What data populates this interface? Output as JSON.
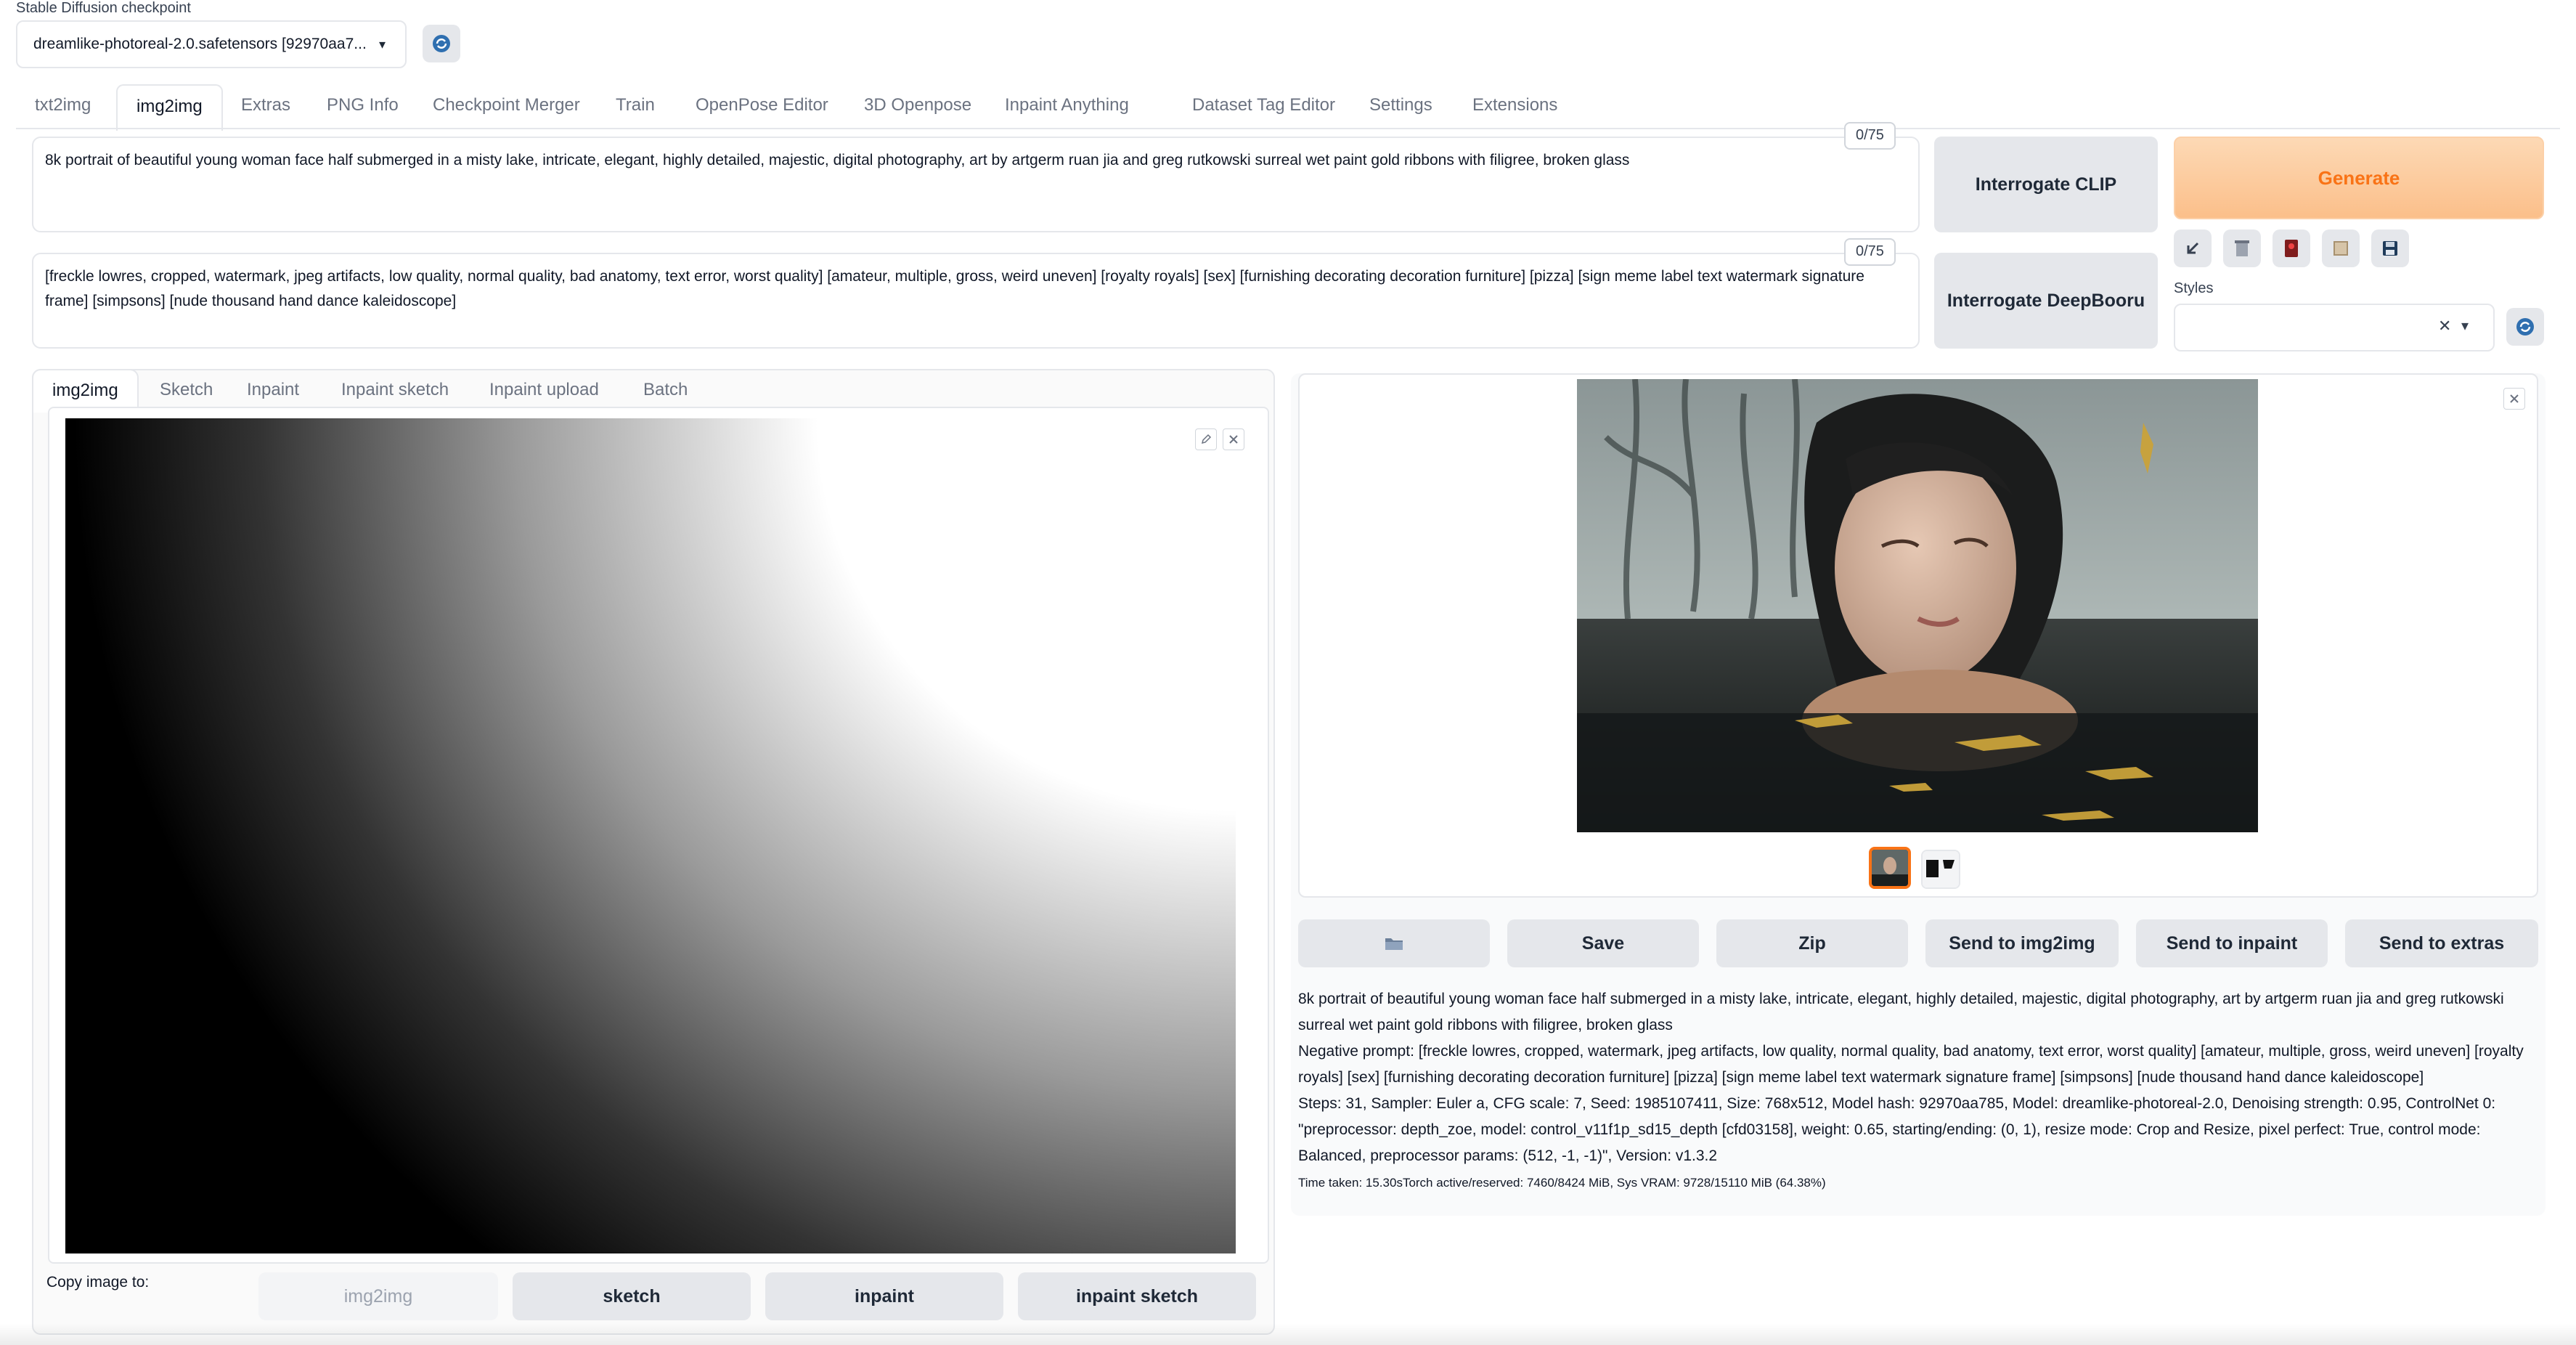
{
  "checkpoint": {
    "label": "Stable Diffusion checkpoint",
    "value": "dreamlike-photoreal-2.0.safetensors [92970aa7..."
  },
  "top_tabs": [
    "txt2img",
    "img2img",
    "Extras",
    "PNG Info",
    "Checkpoint Merger",
    "Train",
    "OpenPose Editor",
    "3D Openpose",
    "Inpaint Anything",
    "Dataset Tag Editor",
    "Settings",
    "Extensions"
  ],
  "prompt": {
    "text": "8k portrait of beautiful young woman face half submerged in a misty lake, intricate, elegant, highly detailed, majestic, digital photography, art by artgerm ruan jia and greg rutkowski surreal wet paint gold ribbons with filigree, broken glass",
    "counter": "0/75"
  },
  "negative_prompt": {
    "text": "[freckle lowres, cropped, watermark, jpeg artifacts, low quality, normal quality, bad anatomy, text error, worst quality] [amateur, multiple, gross, weird uneven] [royalty royals] [sex] [furnishing decorating decoration furniture] [pizza] [sign meme label text watermark signature frame] [simpsons] [nude thousand hand dance kaleidoscope]",
    "counter": "0/75"
  },
  "buttons": {
    "interrogate_clip": "Interrogate CLIP",
    "interrogate_deepbooru": "Interrogate DeepBooru",
    "generate": "Generate"
  },
  "styles": {
    "label": "Styles",
    "clear_glyph": "✕",
    "dropdown_glyph": "▾"
  },
  "sub_tabs": [
    "img2img",
    "Sketch",
    "Inpaint",
    "Inpaint sketch",
    "Inpaint upload",
    "Batch"
  ],
  "copy_image": {
    "label": "Copy image to:",
    "buttons": [
      "img2img",
      "sketch",
      "inpaint",
      "inpaint sketch"
    ]
  },
  "output_actions": [
    "Save",
    "Zip",
    "Send to img2img",
    "Send to inpaint",
    "Send to extras"
  ],
  "generation_info": {
    "prompt": "8k portrait of beautiful young woman face half submerged in a misty lake, intricate, elegant, highly detailed, majestic, digital photography, art by artgerm ruan jia and greg rutkowski surreal wet paint gold ribbons with filigree, broken glass",
    "negative": "Negative prompt: [freckle lowres, cropped, watermark, jpeg artifacts, low quality, normal quality, bad anatomy, text error, worst quality] [amateur, multiple, gross, weird uneven] [royalty royals] [sex] [furnishing decorating decoration furniture] [pizza] [sign meme label text watermark signature frame] [simpsons] [nude thousand hand dance kaleidoscope]",
    "params": "Steps: 31, Sampler: Euler a, CFG scale: 7, Seed: 1985107411, Size: 768x512, Model hash: 92970aa785, Model: dreamlike-photoreal-2.0, Denoising strength: 0.95, ControlNet 0: \"preprocessor: depth_zoe, model: control_v11f1p_sd15_depth [cfd03158], weight: 0.65, starting/ending: (0, 1), resize mode: Crop and Resize, pixel perfect: True, control mode: Balanced, preprocessor params: (512, -1, -1)\", Version: v1.3.2",
    "timing": "Time taken: 15.30sTorch active/reserved: 7460/8424 MiB, Sys VRAM: 9728/15110 MiB (64.38%)"
  },
  "colors": {
    "accent": "#f97316",
    "generate_bg": "#fcc89b",
    "tab_border": "#e5e7eb"
  }
}
